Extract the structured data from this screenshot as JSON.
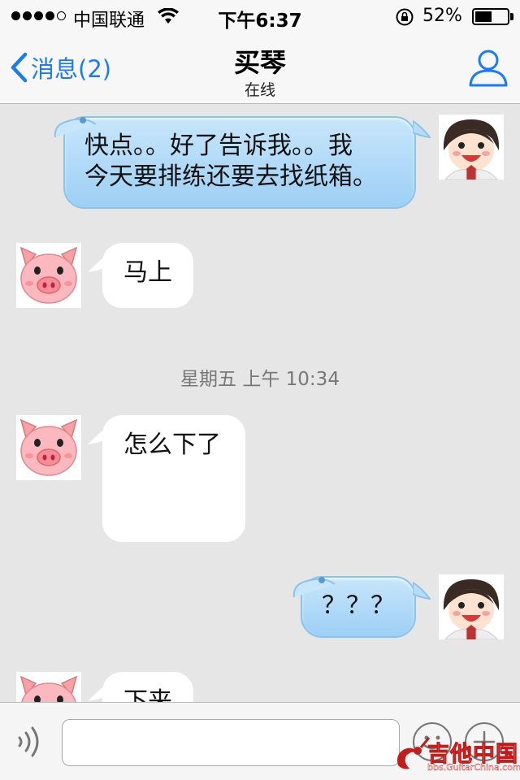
{
  "status_bar": {
    "carrier": "中国联通",
    "time": "下午6:37",
    "battery_percent": "52%",
    "battery_level": 0.52,
    "signal_bars_filled": 4,
    "signal_bars_total": 5
  },
  "nav": {
    "back_label": "消息(2)",
    "title": "买琴",
    "subtitle": "在线",
    "accent_color": "#1a7cf5"
  },
  "messages": [
    {
      "direction": "out",
      "text_line1": "快点。。好了告诉我。。我",
      "text_line2": "今天要排练还要去找纸箱。"
    },
    {
      "direction": "in",
      "text": "马上"
    },
    {
      "timestamp": "星期五 上午 10:34"
    },
    {
      "direction": "in",
      "text": "怎么下了"
    },
    {
      "direction": "out",
      "text": "？？？"
    },
    {
      "direction": "in",
      "text": "下来"
    }
  ],
  "input": {
    "placeholder": ""
  },
  "watermark": {
    "title": "吉他中国",
    "url": "bbs.GuitarChina.com"
  },
  "icons": {
    "back": "chevron-left-icon",
    "contact": "person-icon",
    "voice": "voice-icon",
    "emoji": "emoji-icon",
    "plus": "plus-icon"
  }
}
